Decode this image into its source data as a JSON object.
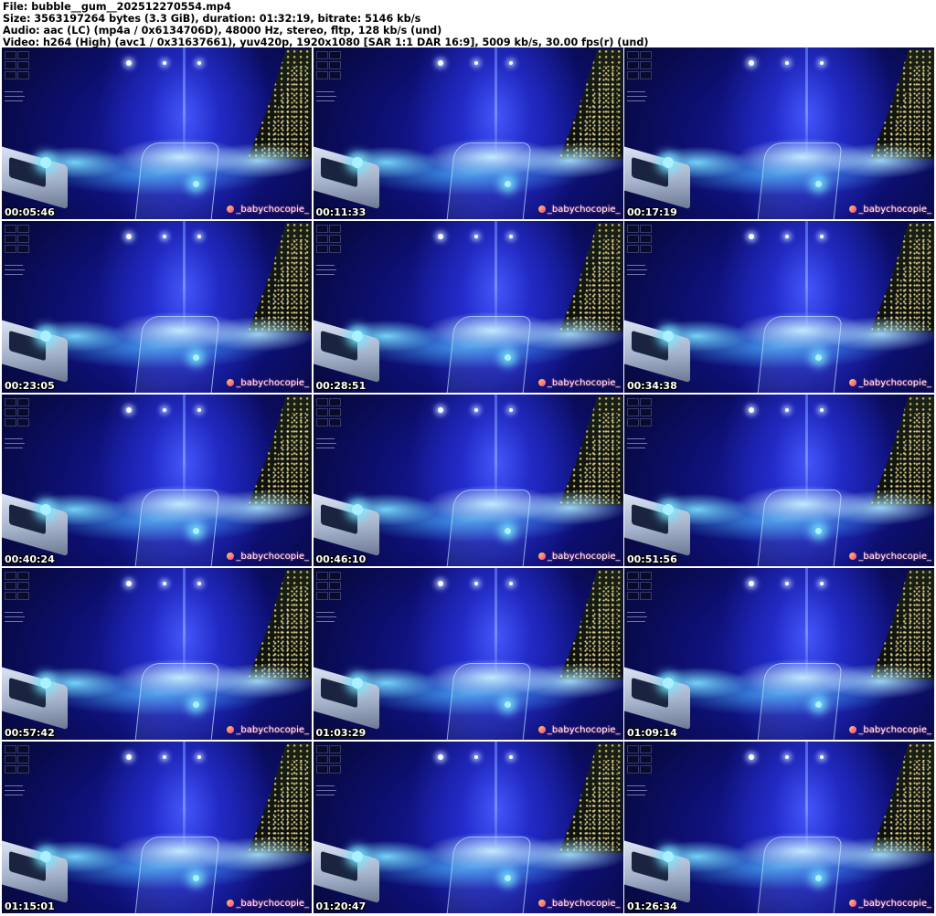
{
  "header": {
    "file_line": "File: bubble__gum__202512270554.mp4",
    "size_line": "Size: 3563197264 bytes (3.3 GiB), duration: 01:32:19, bitrate: 5146 kb/s",
    "audio_line": "Audio: aac (LC) (mp4a / 0x6134706D), 48000 Hz, stereo, fltp, 128 kb/s (und)",
    "video_line": "Video: h264 (High) (avc1 / 0x31637661), yuv420p, 1920x1080 [SAR 1:1 DAR 16:9], 5009 kb/s, 30.00 fps(r) (und)"
  },
  "thumbnails": [
    {
      "timestamp": "00:05:46",
      "watermark": "_babychocopie_"
    },
    {
      "timestamp": "00:11:33",
      "watermark": "_babychocopie_"
    },
    {
      "timestamp": "00:17:19",
      "watermark": "_babychocopie_"
    },
    {
      "timestamp": "00:23:05",
      "watermark": "_babychocopie_"
    },
    {
      "timestamp": "00:28:51",
      "watermark": "_babychocopie_"
    },
    {
      "timestamp": "00:34:38",
      "watermark": "_babychocopie_"
    },
    {
      "timestamp": "00:40:24",
      "watermark": "_babychocopie_"
    },
    {
      "timestamp": "00:46:10",
      "watermark": "_babychocopie_"
    },
    {
      "timestamp": "00:51:56",
      "watermark": "_babychocopie_"
    },
    {
      "timestamp": "00:57:42",
      "watermark": "_babychocopie_"
    },
    {
      "timestamp": "01:03:29",
      "watermark": "_babychocopie_"
    },
    {
      "timestamp": "01:09:14",
      "watermark": "_babychocopie_"
    },
    {
      "timestamp": "01:15:01",
      "watermark": "_babychocopie_"
    },
    {
      "timestamp": "01:20:47",
      "watermark": "_babychocopie_"
    },
    {
      "timestamp": "01:26:34",
      "watermark": "_babychocopie_"
    }
  ]
}
